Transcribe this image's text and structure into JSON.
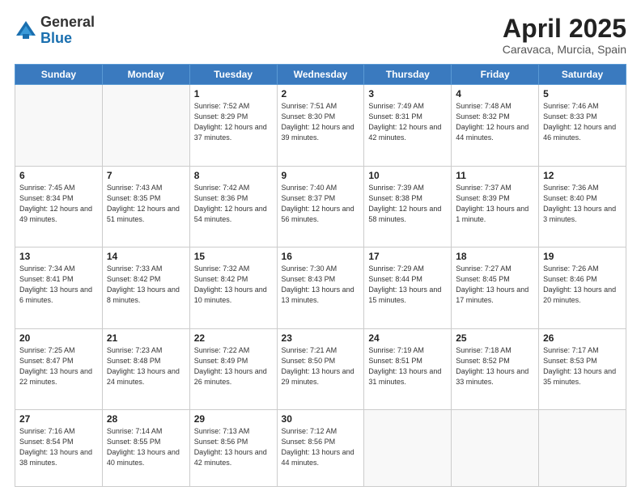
{
  "header": {
    "logo_general": "General",
    "logo_blue": "Blue",
    "title": "April 2025",
    "location": "Caravaca, Murcia, Spain"
  },
  "weekdays": [
    "Sunday",
    "Monday",
    "Tuesday",
    "Wednesday",
    "Thursday",
    "Friday",
    "Saturday"
  ],
  "weeks": [
    [
      {
        "day": "",
        "info": ""
      },
      {
        "day": "",
        "info": ""
      },
      {
        "day": "1",
        "info": "Sunrise: 7:52 AM\nSunset: 8:29 PM\nDaylight: 12 hours and 37 minutes."
      },
      {
        "day": "2",
        "info": "Sunrise: 7:51 AM\nSunset: 8:30 PM\nDaylight: 12 hours and 39 minutes."
      },
      {
        "day": "3",
        "info": "Sunrise: 7:49 AM\nSunset: 8:31 PM\nDaylight: 12 hours and 42 minutes."
      },
      {
        "day": "4",
        "info": "Sunrise: 7:48 AM\nSunset: 8:32 PM\nDaylight: 12 hours and 44 minutes."
      },
      {
        "day": "5",
        "info": "Sunrise: 7:46 AM\nSunset: 8:33 PM\nDaylight: 12 hours and 46 minutes."
      }
    ],
    [
      {
        "day": "6",
        "info": "Sunrise: 7:45 AM\nSunset: 8:34 PM\nDaylight: 12 hours and 49 minutes."
      },
      {
        "day": "7",
        "info": "Sunrise: 7:43 AM\nSunset: 8:35 PM\nDaylight: 12 hours and 51 minutes."
      },
      {
        "day": "8",
        "info": "Sunrise: 7:42 AM\nSunset: 8:36 PM\nDaylight: 12 hours and 54 minutes."
      },
      {
        "day": "9",
        "info": "Sunrise: 7:40 AM\nSunset: 8:37 PM\nDaylight: 12 hours and 56 minutes."
      },
      {
        "day": "10",
        "info": "Sunrise: 7:39 AM\nSunset: 8:38 PM\nDaylight: 12 hours and 58 minutes."
      },
      {
        "day": "11",
        "info": "Sunrise: 7:37 AM\nSunset: 8:39 PM\nDaylight: 13 hours and 1 minute."
      },
      {
        "day": "12",
        "info": "Sunrise: 7:36 AM\nSunset: 8:40 PM\nDaylight: 13 hours and 3 minutes."
      }
    ],
    [
      {
        "day": "13",
        "info": "Sunrise: 7:34 AM\nSunset: 8:41 PM\nDaylight: 13 hours and 6 minutes."
      },
      {
        "day": "14",
        "info": "Sunrise: 7:33 AM\nSunset: 8:42 PM\nDaylight: 13 hours and 8 minutes."
      },
      {
        "day": "15",
        "info": "Sunrise: 7:32 AM\nSunset: 8:42 PM\nDaylight: 13 hours and 10 minutes."
      },
      {
        "day": "16",
        "info": "Sunrise: 7:30 AM\nSunset: 8:43 PM\nDaylight: 13 hours and 13 minutes."
      },
      {
        "day": "17",
        "info": "Sunrise: 7:29 AM\nSunset: 8:44 PM\nDaylight: 13 hours and 15 minutes."
      },
      {
        "day": "18",
        "info": "Sunrise: 7:27 AM\nSunset: 8:45 PM\nDaylight: 13 hours and 17 minutes."
      },
      {
        "day": "19",
        "info": "Sunrise: 7:26 AM\nSunset: 8:46 PM\nDaylight: 13 hours and 20 minutes."
      }
    ],
    [
      {
        "day": "20",
        "info": "Sunrise: 7:25 AM\nSunset: 8:47 PM\nDaylight: 13 hours and 22 minutes."
      },
      {
        "day": "21",
        "info": "Sunrise: 7:23 AM\nSunset: 8:48 PM\nDaylight: 13 hours and 24 minutes."
      },
      {
        "day": "22",
        "info": "Sunrise: 7:22 AM\nSunset: 8:49 PM\nDaylight: 13 hours and 26 minutes."
      },
      {
        "day": "23",
        "info": "Sunrise: 7:21 AM\nSunset: 8:50 PM\nDaylight: 13 hours and 29 minutes."
      },
      {
        "day": "24",
        "info": "Sunrise: 7:19 AM\nSunset: 8:51 PM\nDaylight: 13 hours and 31 minutes."
      },
      {
        "day": "25",
        "info": "Sunrise: 7:18 AM\nSunset: 8:52 PM\nDaylight: 13 hours and 33 minutes."
      },
      {
        "day": "26",
        "info": "Sunrise: 7:17 AM\nSunset: 8:53 PM\nDaylight: 13 hours and 35 minutes."
      }
    ],
    [
      {
        "day": "27",
        "info": "Sunrise: 7:16 AM\nSunset: 8:54 PM\nDaylight: 13 hours and 38 minutes."
      },
      {
        "day": "28",
        "info": "Sunrise: 7:14 AM\nSunset: 8:55 PM\nDaylight: 13 hours and 40 minutes."
      },
      {
        "day": "29",
        "info": "Sunrise: 7:13 AM\nSunset: 8:56 PM\nDaylight: 13 hours and 42 minutes."
      },
      {
        "day": "30",
        "info": "Sunrise: 7:12 AM\nSunset: 8:56 PM\nDaylight: 13 hours and 44 minutes."
      },
      {
        "day": "",
        "info": ""
      },
      {
        "day": "",
        "info": ""
      },
      {
        "day": "",
        "info": ""
      }
    ]
  ]
}
